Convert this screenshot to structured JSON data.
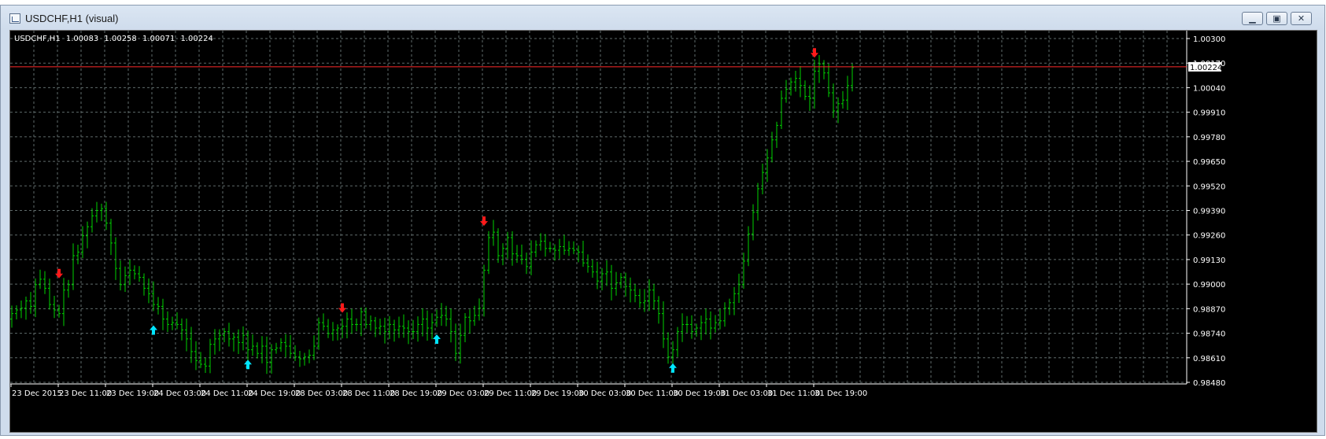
{
  "window": {
    "title": "USDCHF,H1 (visual)",
    "minimize_glyph": "▁",
    "restore_glyph": "▣",
    "close_glyph": "✕"
  },
  "chart": {
    "header_symbol": "USDCHF,H1",
    "header_values": [
      "1.00083",
      "1.00258",
      "1.00071",
      "1.00224"
    ],
    "current_price_label": "1.00224",
    "colors": {
      "background": "#000000",
      "grid": "#5f6b6b",
      "bars": "#00d200",
      "sell_arrow": "#ff1a1a",
      "buy_arrow": "#00e5ff",
      "price_line": "#ff2a2a",
      "axis_text": "#ffffff"
    }
  },
  "chart_data": {
    "type": "ohlc",
    "ylim": [
      0.9848,
      1.0038
    ],
    "y_ticks": [
      "1.00300",
      "1.00170",
      "1.00040",
      "0.99910",
      "0.99780",
      "0.99650",
      "0.99520",
      "0.99390",
      "0.99260",
      "0.99130",
      "0.99000",
      "0.98870",
      "0.98740",
      "0.98610",
      "0.98480"
    ],
    "x_ticks": [
      "23 Dec 2015",
      "23 Dec 11:00",
      "23 Dec 19:00",
      "24 Dec 03:00",
      "24 Dec 11:00",
      "24 Dec 19:00",
      "28 Dec 03:00",
      "28 Dec 11:00",
      "28 Dec 19:00",
      "29 Dec 03:00",
      "29 Dec 11:00",
      "29 Dec 19:00",
      "30 Dec 03:00",
      "30 Dec 11:00",
      "30 Dec 19:00",
      "31 Dec 03:00",
      "31 Dec 11:00",
      "31 Dec 19:00"
    ],
    "current_price": 1.00224,
    "price_path": [
      0.9886,
      0.9888,
      0.9889,
      0.9893,
      0.989,
      0.9902,
      0.9905,
      0.99,
      0.9891,
      0.9888,
      0.9886,
      0.9899,
      0.9902,
      0.9918,
      0.992,
      0.9929,
      0.9934,
      0.994,
      0.9943,
      0.9944,
      0.9936,
      0.9925,
      0.9911,
      0.9902,
      0.9907,
      0.991,
      0.9908,
      0.9906,
      0.99,
      0.9897,
      0.9891,
      0.989,
      0.9883,
      0.988,
      0.9881,
      0.988,
      0.9877,
      0.9872,
      0.9865,
      0.986,
      0.9858,
      0.9857,
      0.9869,
      0.9872,
      0.9874,
      0.9876,
      0.9872,
      0.9873,
      0.987,
      0.9874,
      0.9866,
      0.9868,
      0.9864,
      0.9868,
      0.9859,
      0.9866,
      0.9867,
      0.987,
      0.9868,
      0.9864,
      0.9862,
      0.9861,
      0.9862,
      0.9863,
      0.9868,
      0.9881,
      0.9879,
      0.9875,
      0.9877,
      0.9878,
      0.9879,
      0.9883,
      0.988,
      0.988,
      0.9887,
      0.988,
      0.9882,
      0.9878,
      0.9879,
      0.9876,
      0.988,
      0.9877,
      0.9879,
      0.9878,
      0.9876,
      0.9876,
      0.988,
      0.9883,
      0.9878,
      0.9881,
      0.9884,
      0.9885,
      0.9883,
      0.9876,
      0.9864,
      0.9874,
      0.9884,
      0.9882,
      0.9885,
      0.9889,
      0.991,
      0.9928,
      0.9931,
      0.9918,
      0.9922,
      0.9928,
      0.9919,
      0.9918,
      0.9916,
      0.9912,
      0.992,
      0.9924,
      0.9926,
      0.9922,
      0.9922,
      0.9921,
      0.9923,
      0.9921,
      0.9922,
      0.9921,
      0.992,
      0.9914,
      0.9912,
      0.9909,
      0.9904,
      0.9908,
      0.9909,
      0.99,
      0.9903,
      0.9906,
      0.9901,
      0.9899,
      0.9896,
      0.9892,
      0.9893,
      0.9899,
      0.9893,
      0.9886,
      0.9872,
      0.9862,
      0.9866,
      0.9876,
      0.988,
      0.988,
      0.9876,
      0.9878,
      0.9881,
      0.9883,
      0.9878,
      0.9881,
      0.9882,
      0.9889,
      0.9892,
      0.9897,
      0.9902,
      0.9915,
      0.993,
      0.9942,
      0.9955,
      0.9964,
      0.9972,
      0.9982,
      0.999,
      1.0005,
      1.001,
      1.0014,
      1.0016,
      1.0012,
      1.0006,
      1.0005,
      1.002,
      1.0024,
      1.0019,
      1.0008,
      0.9998,
      1.0002,
      1.0004,
      1.0012,
      1.0022
    ],
    "sell_signals": [
      "23 Dec 11:00",
      "28 Dec 11:00",
      "29 Dec 11:00",
      "31 Dec 19:00"
    ],
    "buy_signals": [
      "24 Dec 03:00",
      "24 Dec 19:00",
      "29 Dec 03:00",
      "30 Dec 19:00"
    ]
  }
}
